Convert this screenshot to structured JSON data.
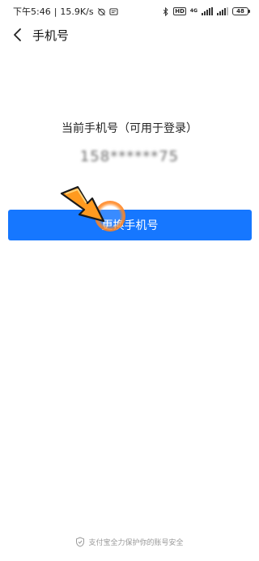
{
  "status_bar": {
    "time": "下午5:46",
    "network_speed": "15.9K/s",
    "network_type": "4G",
    "hd_label": "HD",
    "battery": "48"
  },
  "nav": {
    "title": "手机号"
  },
  "main": {
    "current_label": "当前手机号（可用于登录）",
    "phone_number": "158******75",
    "change_button_label": "更换手机号"
  },
  "footer": {
    "text": "支付宝全力保护你的账号安全"
  },
  "colors": {
    "primary": "#1677ff",
    "highlight": "#ff8a1f"
  }
}
